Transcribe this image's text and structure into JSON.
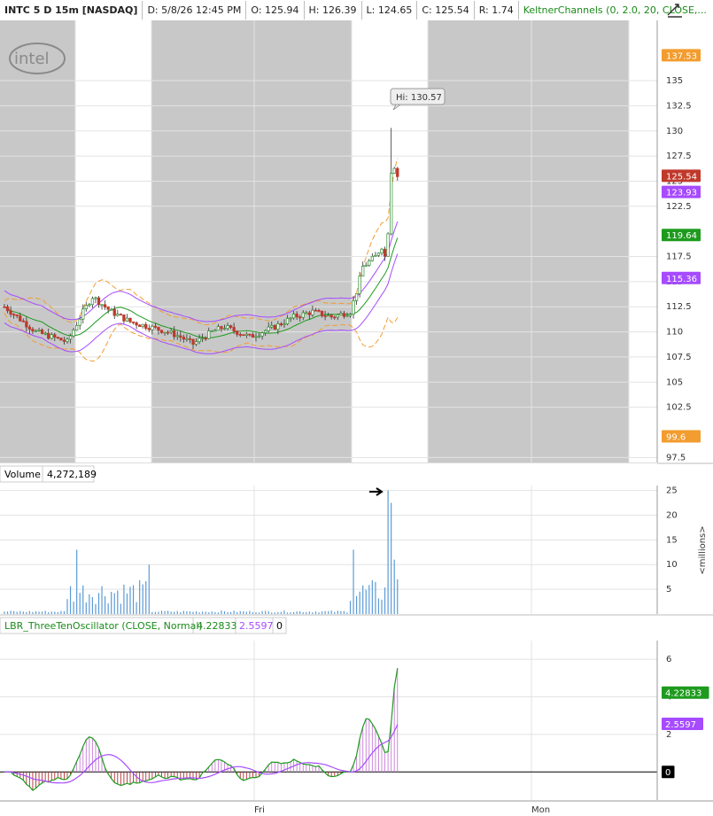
{
  "header": {
    "symbol": "INTC 5 D 15m [NASDAQ]",
    "date": "D: 5/8/26 12:45 PM",
    "open": "O: 125.94",
    "high": "H: 126.39",
    "low": "L: 124.65",
    "close": "C: 125.54",
    "range": "R: 1.74",
    "study": "KeltnerChannels (0, 2.0, 20, CLOSE,...",
    "icon": "drawing-tools-icon"
  },
  "logo": "intel",
  "price_pane": {
    "y_ticks": [
      "135",
      "132.5",
      "130",
      "127.5",
      "125",
      "122.5",
      "117.5",
      "115",
      "112.5",
      "110",
      "107.5",
      "105",
      "102.5",
      "97.5"
    ],
    "y_range": [
      97,
      141
    ],
    "callout": "Hi: 130.57",
    "badges": [
      {
        "value": "137.53",
        "color": "#f39c2f"
      },
      {
        "value": "125.54",
        "color": "#c0392b"
      },
      {
        "value": "123.93",
        "color": "#a64bff"
      },
      {
        "value": "119.64",
        "color": "#1e9b1e"
      },
      {
        "value": "115.36",
        "color": "#a64bff"
      },
      {
        "value": "99.6",
        "color": "#f39c2f"
      }
    ]
  },
  "volume_pane": {
    "title": "Volume",
    "value": "4,272,189",
    "y_ticks": [
      "25",
      "20",
      "15",
      "10",
      "5"
    ],
    "unit": "<millions>"
  },
  "osc_pane": {
    "title": "LBR_ThreeTenOscillator (CLOSE, Normal)",
    "v1": "4.22833",
    "v2": "2.5597",
    "v3": "0",
    "y_ticks": [
      "6",
      "4",
      "2"
    ],
    "badges": [
      {
        "value": "4.22833",
        "color": "#1e9b1e"
      },
      {
        "value": "2.5597",
        "color": "#a64bff"
      },
      {
        "value": "0",
        "color": "#000000"
      }
    ]
  },
  "x_axis": {
    "labels": [
      "Fri",
      "Mon"
    ]
  },
  "colors": {
    "session_shade": "#c8c8c8",
    "up_candle": "#2e8b2e",
    "down_candle": "#c0392b",
    "bollinger": "#f39c2f",
    "keltner": "#a64bff",
    "middle": "#1e9b1e",
    "volume": "#5b9bd5"
  }
}
